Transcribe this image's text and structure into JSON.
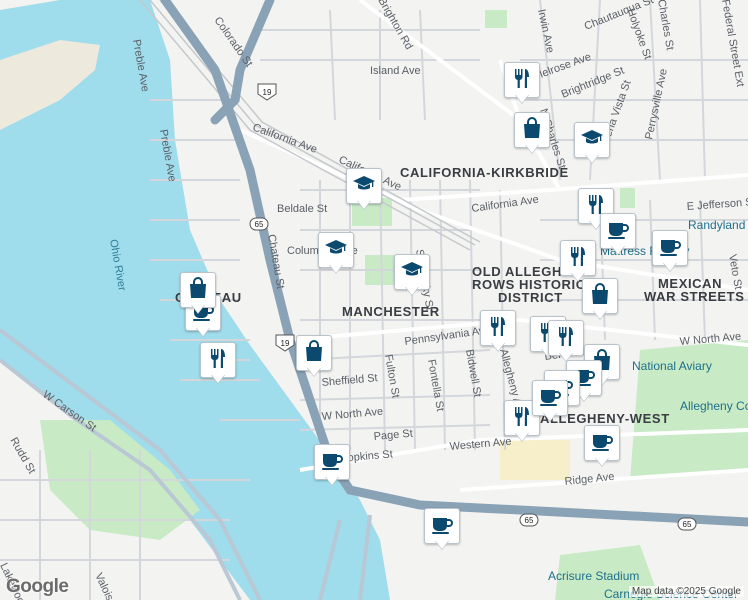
{
  "map": {
    "neighborhoods": [
      "CALIFORNIA-KIRKBRIDE",
      "MANCHESTER",
      "OLD ALLEGHENY",
      "ROWS HISTORIC",
      "DISTRICT",
      "MEXICAN",
      "WAR STREETS",
      "ALLEGHENY-WEST",
      "CHATEAU"
    ],
    "streets": [
      "Preble Ave",
      "Colorado St",
      "Island Ave",
      "California Ave",
      "Beldale St",
      "Columbus Ave",
      "Chateau St",
      "Pennsylvania Ave",
      "Sheffield St",
      "W North Ave",
      "Fulton St",
      "Fontella St",
      "Bidwell St",
      "Page St",
      "Hopkins St",
      "Western Ave",
      "Ridge Ave",
      "W Carson St",
      "Rudd St",
      "Lakewood St",
      "Brighton Rd",
      "Chautauqua St",
      "Irwin Ave",
      "Holyoke St",
      "Buena Vista St",
      "Perrysville Ave",
      "Veto St",
      "E Jefferson St",
      "Sandusky St",
      "Allegheny Ave",
      "Melrose Ave",
      "Brightridge St",
      "N Charles St",
      "Federal Street Ext",
      "Charles St",
      "Behan St",
      "Valois St"
    ],
    "water": "Ohio River",
    "places": [
      "Randyland",
      "National Aviary",
      "Allegheny Commons Park West",
      "Acrisure Stadium",
      "Carnegie Science Center",
      "Mattress Factory"
    ],
    "route_shields": [
      "19",
      "65",
      "19",
      "65",
      "65"
    ],
    "attribution": "Map data ©2025 Google",
    "logo": "Google"
  },
  "markers": [
    {
      "type": "restaurant",
      "icon": "fork-knife-icon"
    },
    {
      "type": "shopping",
      "icon": "shopping-bag-icon"
    },
    {
      "type": "school",
      "icon": "graduation-cap-icon"
    },
    {
      "type": "school",
      "icon": "graduation-cap-icon"
    },
    {
      "type": "school",
      "icon": "graduation-cap-icon"
    },
    {
      "type": "school",
      "icon": "graduation-cap-icon"
    },
    {
      "type": "restaurant",
      "icon": "fork-knife-icon"
    },
    {
      "type": "cafe",
      "icon": "coffee-cup-icon"
    },
    {
      "type": "cafe",
      "icon": "coffee-cup-icon"
    },
    {
      "type": "restaurant",
      "icon": "fork-knife-icon"
    },
    {
      "type": "shopping",
      "icon": "shopping-bag-icon"
    },
    {
      "type": "shopping",
      "icon": "shopping-bag-icon"
    },
    {
      "type": "cafe",
      "icon": "coffee-cup-icon"
    },
    {
      "type": "restaurant",
      "icon": "fork-knife-icon"
    },
    {
      "type": "shopping",
      "icon": "shopping-bag-icon"
    },
    {
      "type": "restaurant",
      "icon": "fork-knife-icon"
    },
    {
      "type": "restaurant",
      "icon": "fork-knife-icon"
    },
    {
      "type": "restaurant",
      "icon": "fork-knife-icon"
    },
    {
      "type": "shopping",
      "icon": "shopping-bag-icon"
    },
    {
      "type": "cafe",
      "icon": "coffee-cup-icon"
    },
    {
      "type": "cafe",
      "icon": "coffee-cup-icon"
    },
    {
      "type": "restaurant",
      "icon": "fork-knife-icon"
    },
    {
      "type": "cafe",
      "icon": "coffee-cup-icon"
    },
    {
      "type": "cafe",
      "icon": "coffee-cup-icon"
    },
    {
      "type": "cafe",
      "icon": "coffee-cup-icon"
    },
    {
      "type": "cafe",
      "icon": "coffee-cup-icon"
    }
  ],
  "colors": {
    "water": "#9fdcec",
    "land": "#f3f3f1",
    "highway": "#8aa2b5",
    "park": "#c8ebc6",
    "marker_icon": "#0b4a6e"
  }
}
